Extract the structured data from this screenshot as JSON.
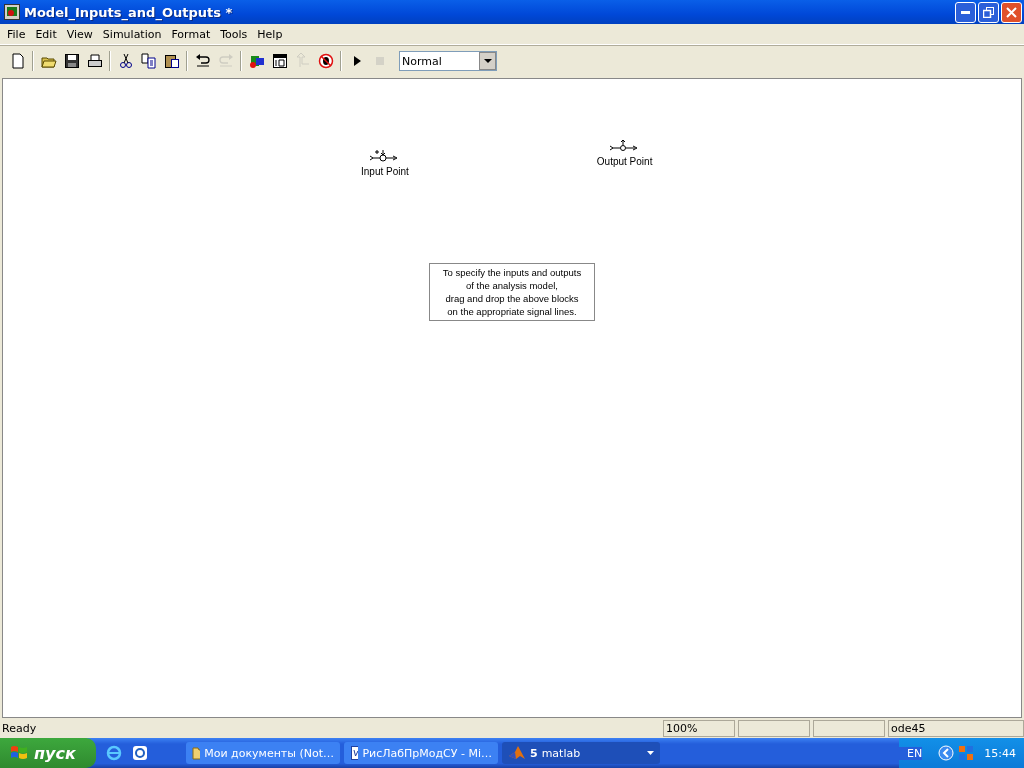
{
  "window": {
    "title": "Model_Inputs_and_Outputs *"
  },
  "menu": [
    "File",
    "Edit",
    "View",
    "Simulation",
    "Format",
    "Tools",
    "Help"
  ],
  "toolbar": [
    {
      "kind": "new",
      "disabled": false
    },
    {
      "kind": "separator"
    },
    {
      "kind": "open",
      "disabled": false
    },
    {
      "kind": "save",
      "disabled": false
    },
    {
      "kind": "print",
      "disabled": false
    },
    {
      "kind": "separator"
    },
    {
      "kind": "cut",
      "disabled": false
    },
    {
      "kind": "copy",
      "disabled": false
    },
    {
      "kind": "paste",
      "disabled": false
    },
    {
      "kind": "separator"
    },
    {
      "kind": "undo",
      "disabled": false
    },
    {
      "kind": "redo",
      "disabled": true
    },
    {
      "kind": "separator"
    },
    {
      "kind": "library",
      "disabled": false
    },
    {
      "kind": "explorer",
      "disabled": false
    },
    {
      "kind": "parent",
      "disabled": true
    },
    {
      "kind": "debug",
      "disabled": false
    },
    {
      "kind": "separator"
    },
    {
      "kind": "run",
      "disabled": false
    },
    {
      "kind": "stop",
      "disabled": true
    }
  ],
  "sim_mode": {
    "value": "Normal"
  },
  "blocks": [
    {
      "kind": "input",
      "label": "Input Point"
    },
    {
      "kind": "output",
      "label": "Output Point"
    }
  ],
  "note": "To specify the inputs and outputs\nof the analysis model,\ndrag and drop the above blocks\non the appropriate signal lines.",
  "status_bar": {
    "message": "Ready",
    "zoom": "100%",
    "solver": "ode45"
  },
  "taskbar": {
    "start": "пуск",
    "tasks": [
      {
        "label": "Мои документы (Not…",
        "selected": false,
        "kind": "folder"
      },
      {
        "label": "РисЛабПрМодСУ - Mi…",
        "selected": false,
        "kind": "word"
      },
      {
        "label": "matlab",
        "count": "5",
        "selected": true,
        "kind": "matlab"
      }
    ],
    "language": "EN",
    "clock": "15:44"
  }
}
